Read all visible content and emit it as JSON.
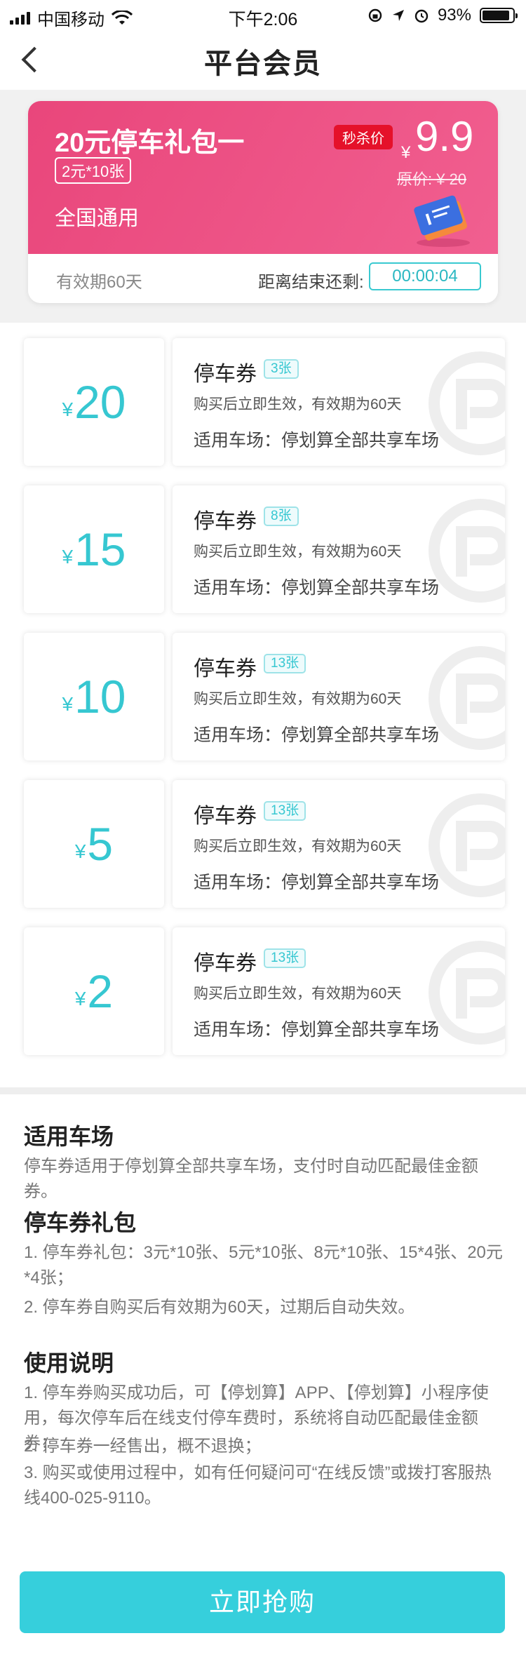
{
  "status_bar": {
    "carrier": "中国移动",
    "time": "下午2:06",
    "battery": "93%"
  },
  "nav": {
    "title": "平台会员"
  },
  "promo": {
    "title": "20元停车礼包一",
    "tag": "2元*10张",
    "scope": "全国通用",
    "flash_label": "秒杀价",
    "currency": "¥",
    "price": "9.9",
    "original_price": "原价: ¥ 20",
    "validity": "有效期60天",
    "countdown_label": "距离结束还剩:",
    "countdown": "00:00:04"
  },
  "coupons": [
    {
      "currency": "¥",
      "amount": "20",
      "title": "停车券",
      "count": "3张",
      "desc": "购买后立即生效，有效期为60天",
      "venue": "适用车场：停划算全部共享车场"
    },
    {
      "currency": "¥",
      "amount": "15",
      "title": "停车券",
      "count": "8张",
      "desc": "购买后立即生效，有效期为60天",
      "venue": "适用车场：停划算全部共享车场"
    },
    {
      "currency": "¥",
      "amount": "10",
      "title": "停车券",
      "count": "13张",
      "desc": "购买后立即生效，有效期为60天",
      "venue": "适用车场：停划算全部共享车场"
    },
    {
      "currency": "¥",
      "amount": "5",
      "title": "停车券",
      "count": "13张",
      "desc": "购买后立即生效，有效期为60天",
      "venue": "适用车场：停划算全部共享车场"
    },
    {
      "currency": "¥",
      "amount": "2",
      "title": "停车券",
      "count": "13张",
      "desc": "购买后立即生效，有效期为60天",
      "venue": "适用车场：停划算全部共享车场"
    }
  ],
  "sections": {
    "venue": {
      "title": "适用车场",
      "text": "停车券适用于停划算全部共享车场，支付时自动匹配最佳金额券。"
    },
    "package": {
      "title": "停车券礼包",
      "line1": "1.  停车券礼包：3元*10张、5元*10张、8元*10张、15*4张、20元*4张；",
      "line2": "2.  停车券自购买后有效期为60天，过期后自动失效。"
    },
    "usage": {
      "title": "使用说明",
      "line1": "1. 停车券购买成功后，可【停划算】APP、【停划算】小程序使用，每次停车后在线支付停车费时，系统将自动匹配最佳金额券；",
      "line2": "2. 停车券一经售出，概不退换；",
      "line3": "3. 购买或使用过程中，如有任何疑问可“在线反馈”或拨打客服热线400-025-9110。"
    }
  },
  "buy_button": {
    "label": "立即抢购"
  },
  "colors": {
    "accent": "#36cfdc",
    "promo": "#ec4c80",
    "flash": "#e5112a"
  }
}
